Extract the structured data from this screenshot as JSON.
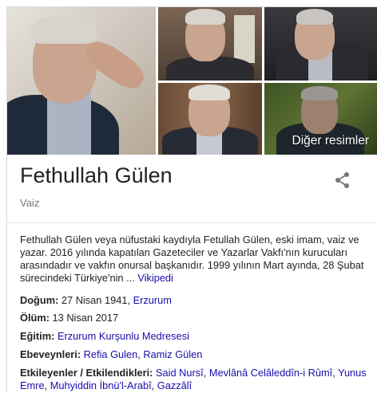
{
  "images": {
    "more_label": "Diğer resimler"
  },
  "entity": {
    "name": "Fethullah Gülen",
    "type": "Vaiz"
  },
  "description": {
    "text": "Fethullah Gülen veya nüfustaki kaydıyla Fetullah Gülen, eski imam, vaiz ve yazar. 2016 yılında kapatılan Gazeteciler ve Yazarlar Vakfı'nın kurucuları arasındadır ve vakfın onursal başkanıdır. 1999 yılının Mart ayında, 28 Şubat sürecindeki Türkiye'nin ...",
    "source": "Vikipedi"
  },
  "facts": {
    "birth": {
      "label": "Doğum:",
      "value": "27 Nisan 1941,",
      "link": "Erzurum"
    },
    "death": {
      "label": "Ölüm:",
      "value": "13 Nisan 2017"
    },
    "education": {
      "label": "Eğitim:",
      "link": "Erzurum Kurşunlu Medresesi"
    },
    "parents": {
      "label": "Ebeveynleri:",
      "links": [
        "Refia Gulen",
        "Ramiz Gülen"
      ]
    },
    "influences": {
      "label": "Etkileyenler / Etkilendikleri:",
      "links": [
        "Said Nursî",
        "Mevlânâ Celâleddîn-i Rûmî",
        "Yunus Emre",
        "Muhyiddin İbnü'l-Arabî",
        "Gazzâlî"
      ]
    }
  },
  "colors": {
    "link": "#1a0dab",
    "title": "#222222",
    "subtitle": "#777777"
  }
}
